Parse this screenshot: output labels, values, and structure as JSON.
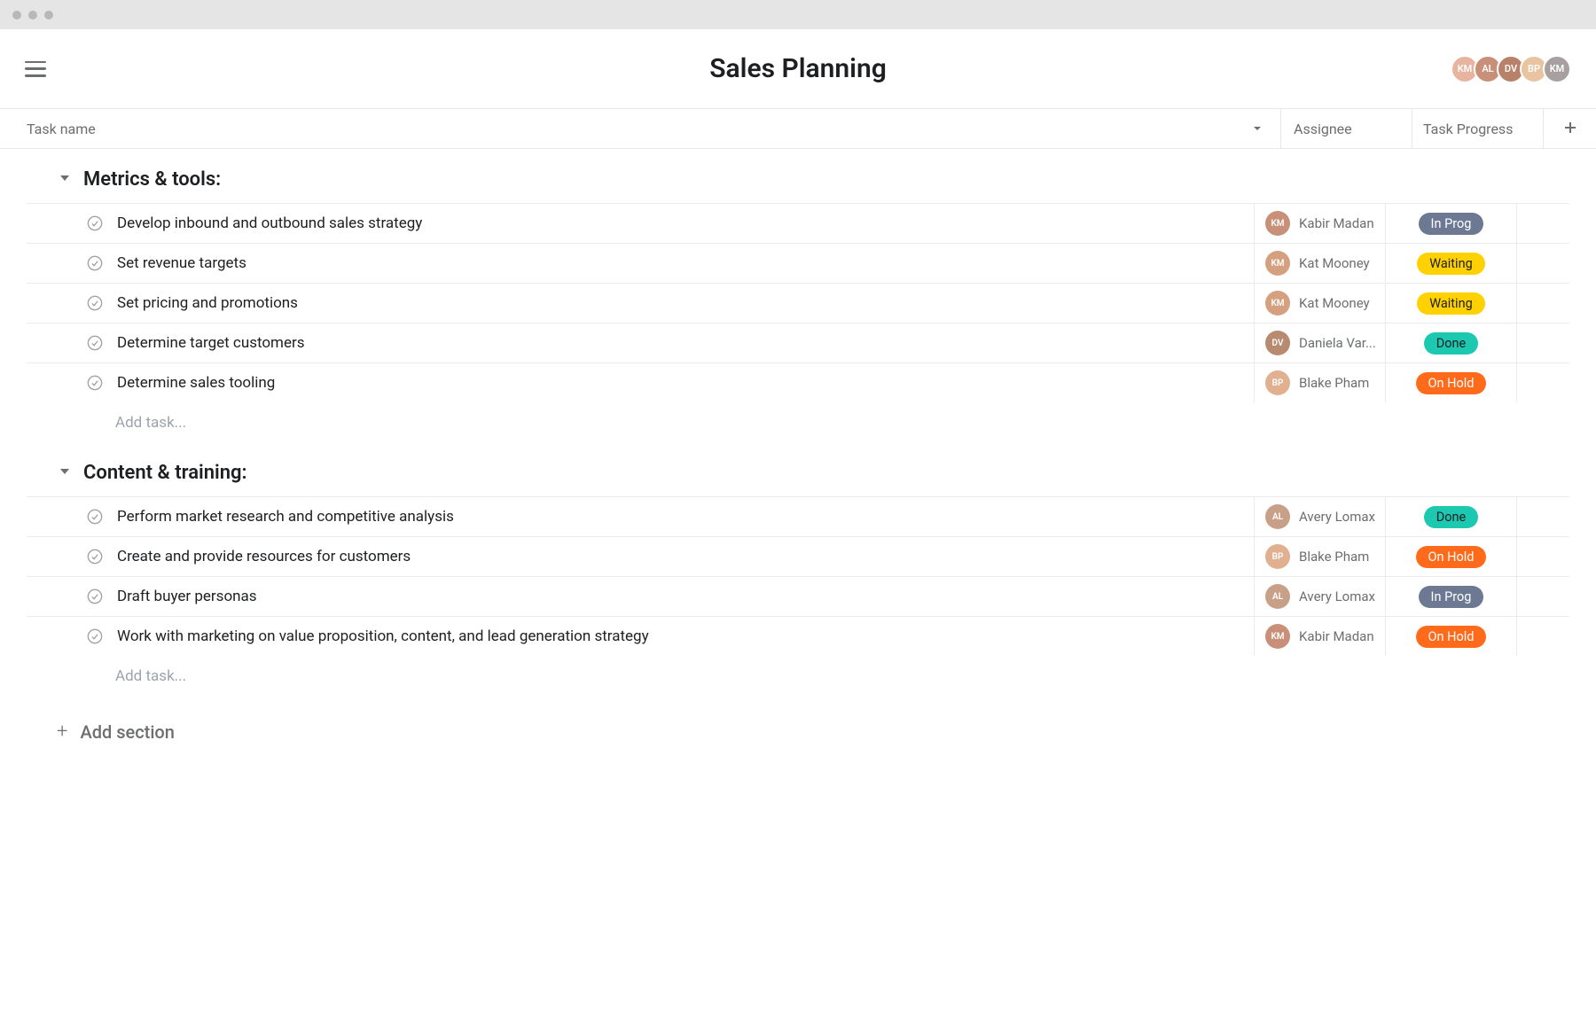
{
  "project_title": "Sales Planning",
  "columns": {
    "task_name": "Task name",
    "assignee": "Assignee",
    "progress": "Task Progress"
  },
  "collaborators": [
    {
      "initials": "KM",
      "color": "#e8b4a0"
    },
    {
      "initials": "AL",
      "color": "#c89078"
    },
    {
      "initials": "DV",
      "color": "#b8826a"
    },
    {
      "initials": "BP",
      "color": "#e8c4a0"
    },
    {
      "initials": "KM",
      "color": "#a8a0a0"
    }
  ],
  "status_colors": {
    "In Prog": "status-in-prog",
    "Waiting": "status-waiting",
    "Done": "status-done",
    "On Hold": "status-on-hold"
  },
  "assignee_colors": {
    "Kabir Madan": "#c89078",
    "Kat Mooney": "#d4a080",
    "Daniela Var...": "#b88a70",
    "Blake Pham": "#e0b090",
    "Avery Lomax": "#c8a088"
  },
  "sections": [
    {
      "title": "Metrics & tools:",
      "tasks": [
        {
          "name": "Develop inbound and outbound sales strategy",
          "assignee": "Kabir Madan",
          "status": "In Prog"
        },
        {
          "name": "Set revenue targets",
          "assignee": "Kat Mooney",
          "status": "Waiting"
        },
        {
          "name": "Set pricing and promotions",
          "assignee": "Kat Mooney",
          "status": "Waiting"
        },
        {
          "name": "Determine target customers",
          "assignee": "Daniela Var...",
          "status": "Done"
        },
        {
          "name": "Determine sales tooling",
          "assignee": "Blake Pham",
          "status": "On Hold"
        }
      ]
    },
    {
      "title": "Content & training:",
      "tasks": [
        {
          "name": "Perform market research and competitive analysis",
          "assignee": "Avery Lomax",
          "status": "Done"
        },
        {
          "name": "Create and provide resources for customers",
          "assignee": "Blake Pham",
          "status": "On Hold"
        },
        {
          "name": "Draft buyer personas",
          "assignee": "Avery Lomax",
          "status": "In Prog"
        },
        {
          "name": "Work with marketing on value proposition, content, and lead generation strategy",
          "assignee": "Kabir Madan",
          "status": "On Hold"
        }
      ]
    }
  ],
  "add_task_label": "Add task...",
  "add_section_label": "Add section"
}
